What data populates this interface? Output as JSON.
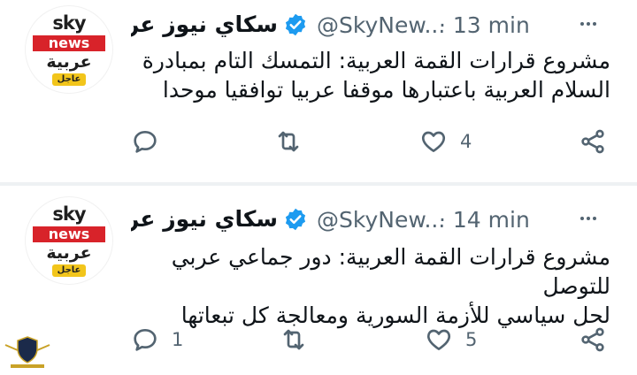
{
  "tweets": [
    {
      "avatar": {
        "sky": "sky",
        "news": "news",
        "arabic": "عربية",
        "urgent": "عاجل"
      },
      "name": "سكاي نيوز عر...",
      "handle": "@SkyNew...",
      "time": "· 13 min",
      "text_line1": "مشروع قرارات القمة العربية: التمسك التام بمبادرة",
      "text_line2": "السلام العربية باعتبارها موقفا عربيا توافقيا موحدا",
      "reply_count": "",
      "retweet_count": "",
      "like_count": "4"
    },
    {
      "avatar": {
        "sky": "sky",
        "news": "news",
        "arabic": "عربية",
        "urgent": "عاجل"
      },
      "name": "سكاي نيوز عر...",
      "handle": "@SkyNew...",
      "time": "· 14 min",
      "text_line1": "مشروع قرارات القمة العربية: دور جماعي عربي للتوصل",
      "text_line2": "لحل سياسي للأزمة السورية ومعالجة كل تبعاتها",
      "reply_count": "1",
      "retweet_count": "",
      "like_count": "5"
    }
  ],
  "colors": {
    "text": "#0f1419",
    "secondary": "#536471",
    "verified": "#1d9bf0",
    "news_red": "#d8232a",
    "urgent_yellow": "#f2c51b"
  },
  "icons": [
    "reply-icon",
    "retweet-icon",
    "like-icon",
    "share-icon",
    "more-icon",
    "verified-icon"
  ]
}
